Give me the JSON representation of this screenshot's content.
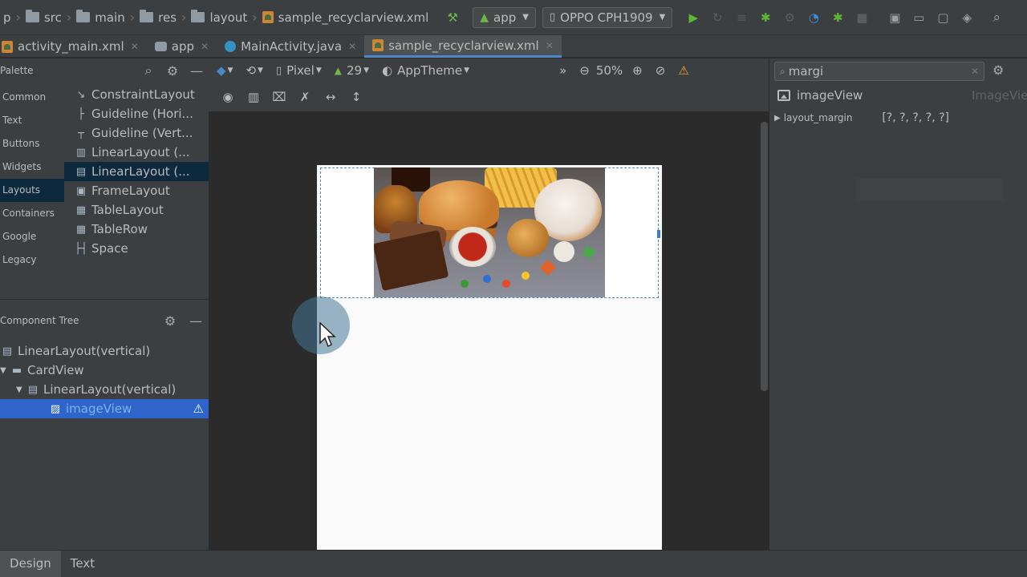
{
  "breadcrumb": {
    "items": [
      "p",
      "src",
      "main",
      "res",
      "layout",
      "sample_recyclarview.xml"
    ]
  },
  "run_toolbar": {
    "module": "app",
    "device": "OPPO CPH1909"
  },
  "editor_tabs": [
    {
      "label": "activity_main.xml",
      "active": false
    },
    {
      "label": "app",
      "active": false
    },
    {
      "label": "MainActivity.java",
      "active": false
    },
    {
      "label": "sample_recyclarview.xml",
      "active": true
    }
  ],
  "palette": {
    "title": "Palette",
    "categories": [
      "Common",
      "Text",
      "Buttons",
      "Widgets",
      "Layouts",
      "Containers",
      "Google",
      "Legacy"
    ],
    "selected_category": "Layouts",
    "items": [
      {
        "label": "ConstraintLayout",
        "icon": "constraint-icon"
      },
      {
        "label": "Guideline (Hori...",
        "icon": "guideline-h-icon"
      },
      {
        "label": "Guideline (Vert...",
        "icon": "guideline-v-icon"
      },
      {
        "label": "LinearLayout (...",
        "icon": "linear-h-icon"
      },
      {
        "label": "LinearLayout (...",
        "icon": "linear-v-icon"
      },
      {
        "label": "FrameLayout",
        "icon": "frame-icon"
      },
      {
        "label": "TableLayout",
        "icon": "table-icon"
      },
      {
        "label": "TableRow",
        "icon": "tablerow-icon"
      },
      {
        "label": "Space",
        "icon": "space-icon"
      }
    ]
  },
  "component_tree": {
    "title": "Component Tree",
    "rows": [
      {
        "label": "LinearLayout",
        "suffix": "(vertical)",
        "depth": 0,
        "expander": "",
        "selected": false
      },
      {
        "label": "CardView",
        "suffix": "",
        "depth": 0,
        "expander": "▼",
        "selected": false
      },
      {
        "label": "LinearLayout",
        "suffix": "(vertical)",
        "depth": 1,
        "expander": "▼",
        "selected": false
      },
      {
        "label": "imageView",
        "suffix": "",
        "depth": 2,
        "expander": "",
        "selected": true,
        "warning": true
      }
    ]
  },
  "design_toolbar": {
    "device": "Pixel",
    "api": "29",
    "theme": "AppTheme",
    "zoom": "50%"
  },
  "attributes": {
    "search_value": "margi",
    "component_name": "imageView",
    "component_type": "ImageView",
    "rows": [
      {
        "name": "layout_margin",
        "value": "[?, ?, ?, ?, ?]"
      }
    ]
  },
  "bottom_tabs": [
    {
      "label": "Design",
      "active": true
    },
    {
      "label": "Text",
      "active": false
    }
  ],
  "colors": {
    "accent": "#4a88c7",
    "selection": "#2f65ca",
    "warning": "#f0a732",
    "run": "#5fb832"
  }
}
